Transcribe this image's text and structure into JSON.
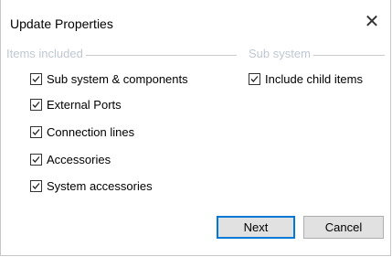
{
  "window": {
    "title": "Update Properties",
    "close_glyph": "✕"
  },
  "items_group": {
    "header": "Items included",
    "checkboxes": [
      {
        "label": "Sub system & components",
        "checked": true
      },
      {
        "label": "External Ports",
        "checked": true
      },
      {
        "label": "Connection lines",
        "checked": true
      },
      {
        "label": "Accessories",
        "checked": true
      },
      {
        "label": "System accessories",
        "checked": true
      }
    ]
  },
  "sub_group": {
    "header": "Sub system",
    "checkboxes": [
      {
        "label": "Include child items",
        "checked": true
      }
    ]
  },
  "buttons": {
    "next_label": "Next",
    "cancel_label": "Cancel"
  },
  "colors": {
    "group_header": "#bfc8d3",
    "default_button_border": "#0078d7",
    "button_bg": "#e1e1e1"
  }
}
